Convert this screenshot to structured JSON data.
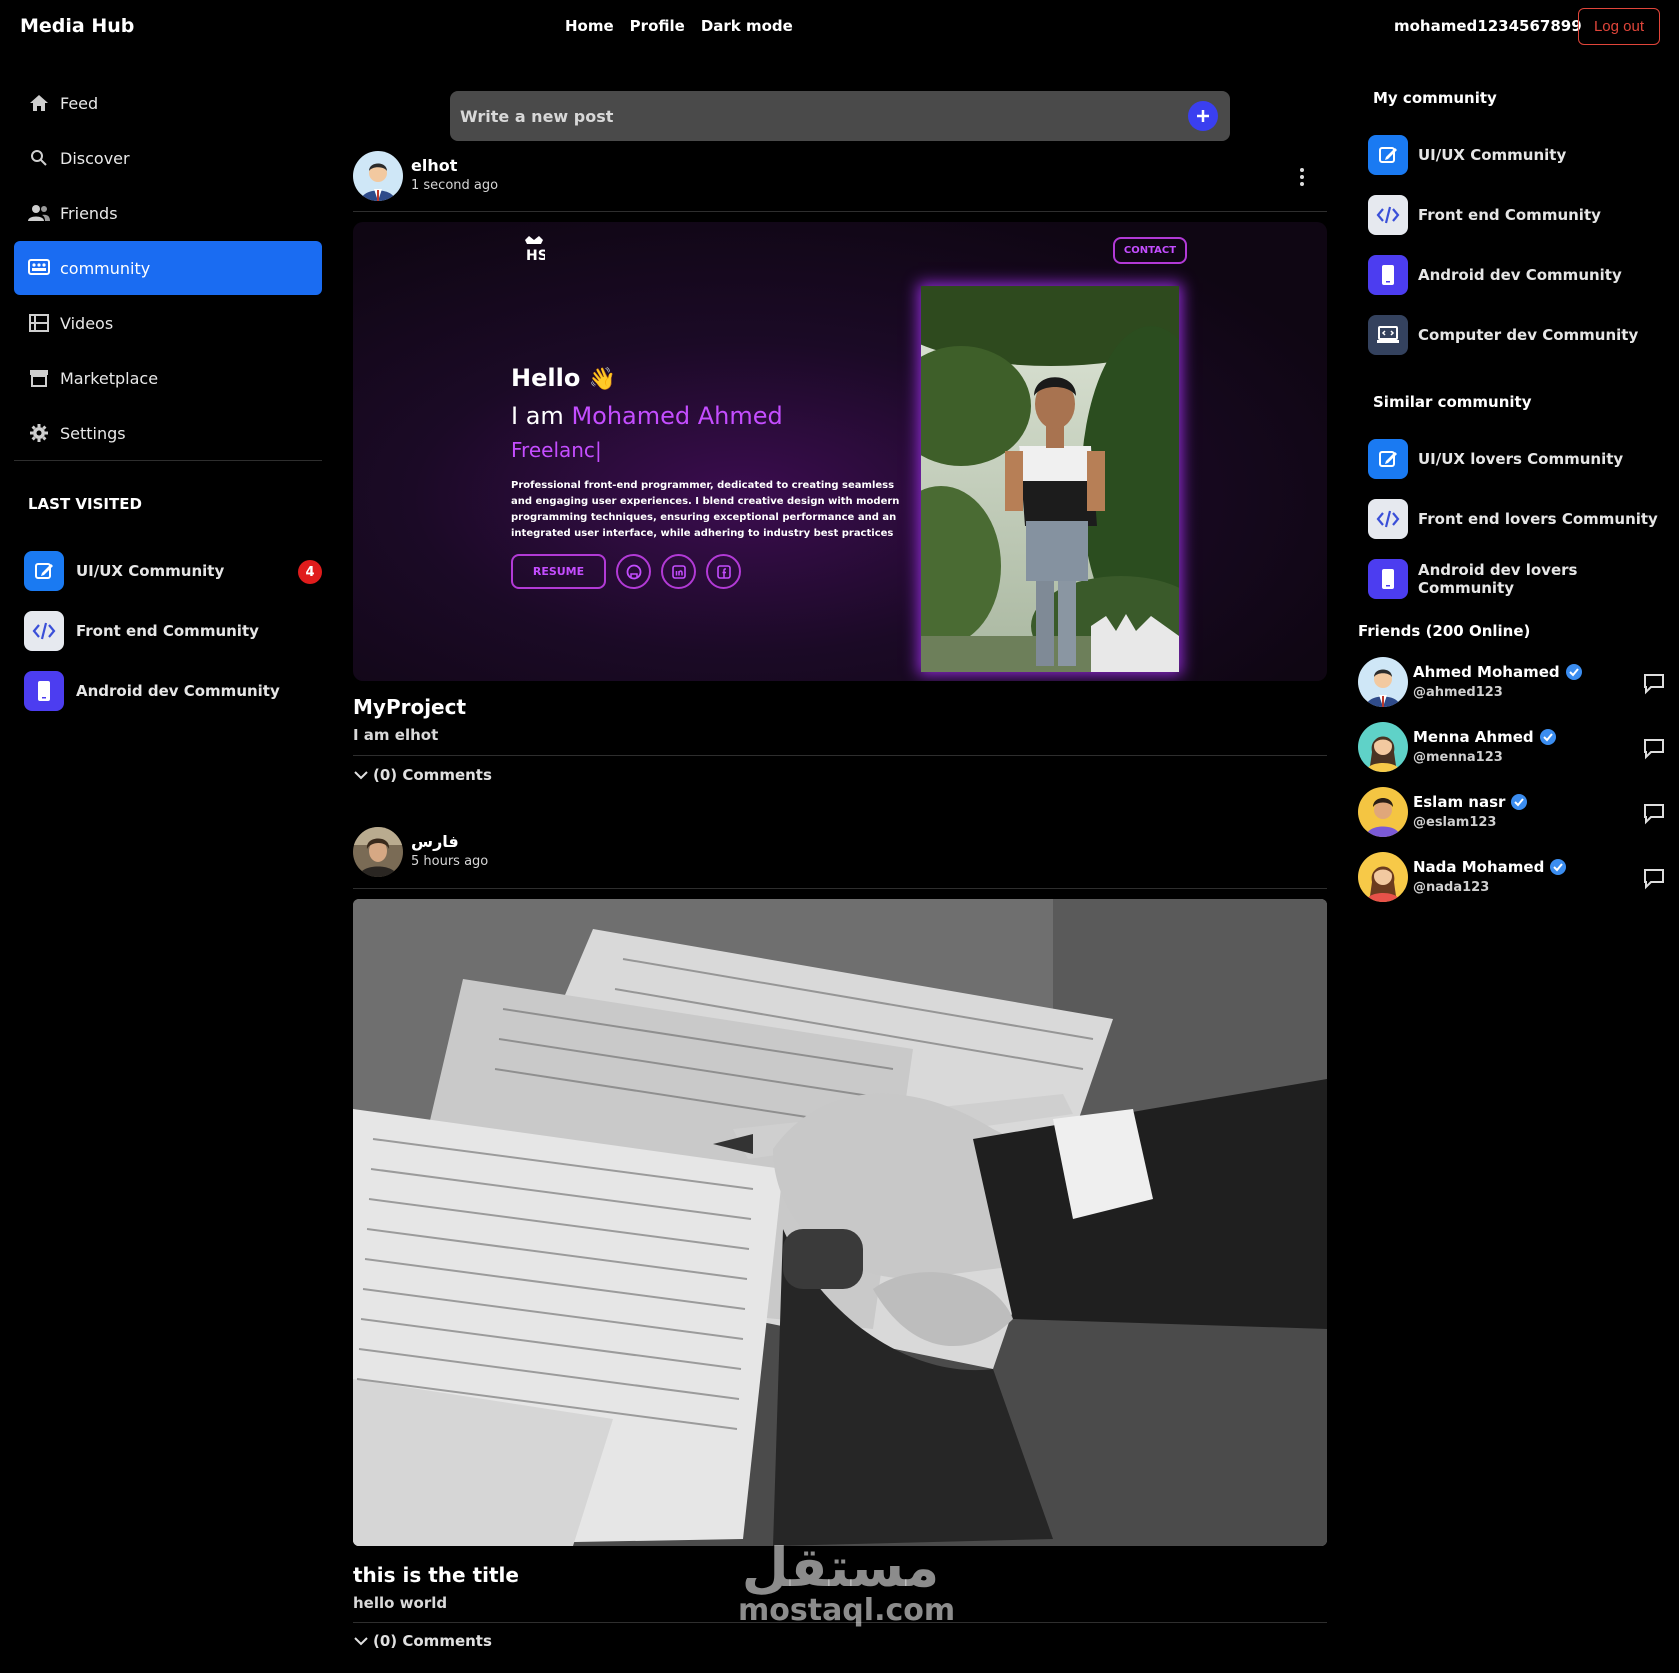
{
  "app": {
    "brand": "Media Hub"
  },
  "topnav": {
    "items": [
      "Home",
      "Profile",
      "Dark mode"
    ],
    "username": "mohamed1234567899",
    "logout": "Log out"
  },
  "sidebar": {
    "items": [
      {
        "label": "Feed",
        "icon": "home-icon"
      },
      {
        "label": "Discover",
        "icon": "search-icon"
      },
      {
        "label": "Friends",
        "icon": "users-icon"
      },
      {
        "label": "community",
        "icon": "community-icon",
        "active": true
      },
      {
        "label": "Videos",
        "icon": "film-icon"
      },
      {
        "label": "Marketplace",
        "icon": "store-icon"
      },
      {
        "label": "Settings",
        "icon": "gear-icon"
      }
    ],
    "last_visited_title": "LAST VISITED",
    "last_visited": [
      {
        "label": "UI/UX Community",
        "icon": "edit-icon",
        "badge": "4"
      },
      {
        "label": "Front end Community",
        "icon": "code-icon"
      },
      {
        "label": "Android dev Community",
        "icon": "phone-icon"
      }
    ]
  },
  "composer": {
    "placeholder": "Write a new post"
  },
  "posts": [
    {
      "author": "elhot",
      "time": "1 second ago",
      "title": "MyProject",
      "body": "I am elhot",
      "comments": "(0) Comments",
      "preview": {
        "contact": "CONTACT",
        "hello": "Hello",
        "iam": "I am",
        "name": "Mohamed Ahmed",
        "role": "Freelanc",
        "desc": "Professional front-end programmer, dedicated to creating seamless and engaging user experiences. I blend creative design with modern programming techniques, ensuring exceptional performance and an integrated user interface, while adhering to industry best practices",
        "resume": "RESUME"
      }
    },
    {
      "author": "فارس",
      "time": "5 hours ago",
      "title": "this is the title",
      "body": "hello world",
      "comments": "(0) Comments"
    }
  ],
  "right": {
    "my_community_title": "My community",
    "my_community": [
      {
        "label": "UI/UX Community",
        "icon": "edit-icon"
      },
      {
        "label": "Front end Community",
        "icon": "code-icon"
      },
      {
        "label": "Android dev Community",
        "icon": "phone-icon"
      },
      {
        "label": "Computer dev Community",
        "icon": "laptop-icon"
      }
    ],
    "similar_title": "Similar community",
    "similar": [
      {
        "label": "UI/UX lovers Community",
        "icon": "edit-icon"
      },
      {
        "label": "Front end lovers Community",
        "icon": "code-icon"
      },
      {
        "label": "Android dev lovers Community",
        "icon": "phone-icon"
      }
    ],
    "friends_title": "Friends (200 Online)",
    "friends": [
      {
        "name": "Ahmed Mohamed",
        "handle": "@ahmed123"
      },
      {
        "name": "Menna Ahmed",
        "handle": "@menna123"
      },
      {
        "name": "Eslam nasr",
        "handle": "@eslam123"
      },
      {
        "name": "Nada Mohamed",
        "handle": "@nada123"
      }
    ]
  },
  "watermark": {
    "ar": "مستقل",
    "en": "mostaql.com"
  },
  "colors": {
    "accent": "#1a6cf2",
    "danger": "#e0453a",
    "purple": "#c44dff"
  }
}
